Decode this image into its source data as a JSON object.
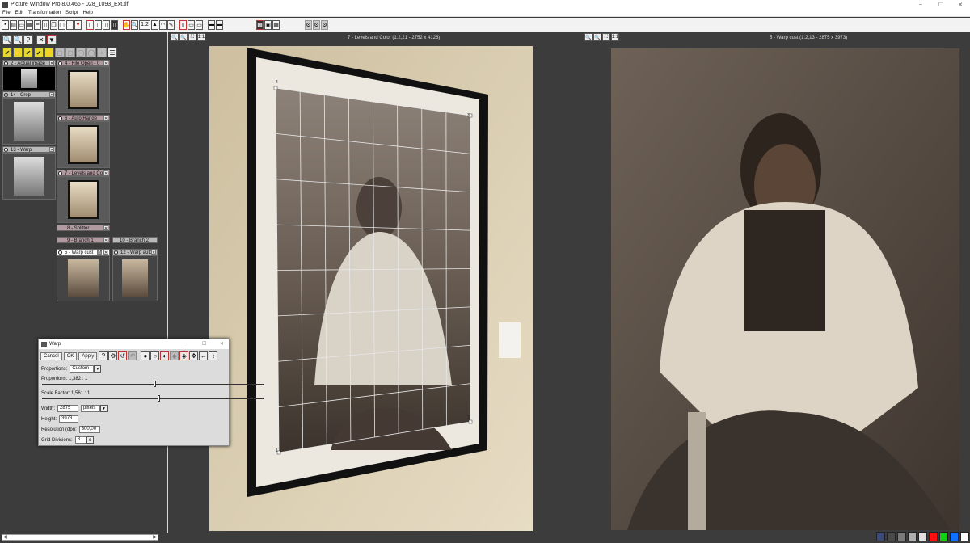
{
  "app": {
    "title": "Picture Window Pro 8.0.466 - 028_1093_Ext.tif",
    "controls": [
      "–",
      "☐",
      "✕"
    ]
  },
  "menu": [
    "File",
    "Edit",
    "Transformation",
    "Script",
    "Help"
  ],
  "toolbar": {
    "icons": [
      "new-icon",
      "open-icon",
      "save-icon",
      "print-icon",
      "list-icon",
      "doc-icon",
      "copy-icon",
      "paste-icon",
      "info-icon",
      "heart-icon",
      "page-icon",
      "page-icon",
      "page-icon",
      "page-icon",
      "hand-icon",
      "zoom-icon",
      "ratio-icon",
      "mountain-icon",
      "brush-icon",
      "pencil-icon",
      "page-icon",
      "split-icon",
      "split-icon",
      "screen-icon",
      "screen-icon",
      "checker-icon",
      "grid-icon",
      "grid-icon",
      "gear-icon",
      "gear-icon",
      "gear-icon"
    ],
    "zoom_label": "1:2",
    "info_label": "i",
    "heart": "♥"
  },
  "left_tools_row1": [
    "🔍",
    "🔍",
    "?",
    "✕",
    "▼"
  ],
  "left_tools_row2": [
    "✔",
    "⚡",
    "✔",
    "✔",
    "⚡",
    "▢",
    "▢",
    "◯",
    "◯",
    "+",
    "☰"
  ],
  "nodes": {
    "n2": {
      "label": "2 - Actual image"
    },
    "n4": {
      "label": "4 - File Open - 0"
    },
    "n14": {
      "label": "14 - Crop"
    },
    "n6": {
      "label": "6 - Auto Range"
    },
    "n13": {
      "label": "13 - Warp"
    },
    "n7": {
      "label": "7 - Levels and Co"
    },
    "n8": {
      "label": "8 - Splitter"
    },
    "n9": {
      "label": "9 - Branch 1"
    },
    "n10": {
      "label": "10 - Branch 2"
    },
    "n5": {
      "label": "5 - Warp cust"
    },
    "n12": {
      "label": "12 - Warp auto"
    },
    "close": "✕",
    "m": "M"
  },
  "doc_left": {
    "title": "7 - Levels and Color (1:2,21 - 2752 x 4128)",
    "tools": [
      "🔍",
      "🔍",
      "⛶",
      "1:1"
    ],
    "grid_labels": [
      "4",
      "3",
      "1",
      "2"
    ]
  },
  "doc_right": {
    "title": "5 - Warp cust (1:2,13 - 2875 x 3973)",
    "tools": [
      "🔍",
      "🔍",
      "⛶",
      "1:1"
    ]
  },
  "warp_dialog": {
    "title": "Warp",
    "controls": [
      "–",
      "☐",
      "✕"
    ],
    "buttons": {
      "cancel": "Cancel",
      "ok": "OK",
      "apply": "Apply",
      "help": "?"
    },
    "proportions_label": "Proportions:",
    "proportions_value": "Custom",
    "proportions_ratio": "Proportions: 1,382 : 1",
    "proportions_slider": 0.5,
    "scale_label": "Scale Factor: 1,561 : 1",
    "scale_slider": 0.52,
    "width_label": "Width:",
    "width_value": "2875",
    "units_value": "pixels",
    "height_label": "Height:",
    "height_value": "3973",
    "resolution_label": "Resolution (dpi):",
    "resolution_value": "300,00",
    "grid_label": "Grid Divisions:",
    "grid_value": "8"
  },
  "status_colors": [
    "#3b4a7a",
    "#4a4a4a",
    "#7a7a7a",
    "#b0b0b0",
    "#e0e0e0",
    "#ff1010",
    "#10d010",
    "#1070ff",
    "#ffffff"
  ]
}
